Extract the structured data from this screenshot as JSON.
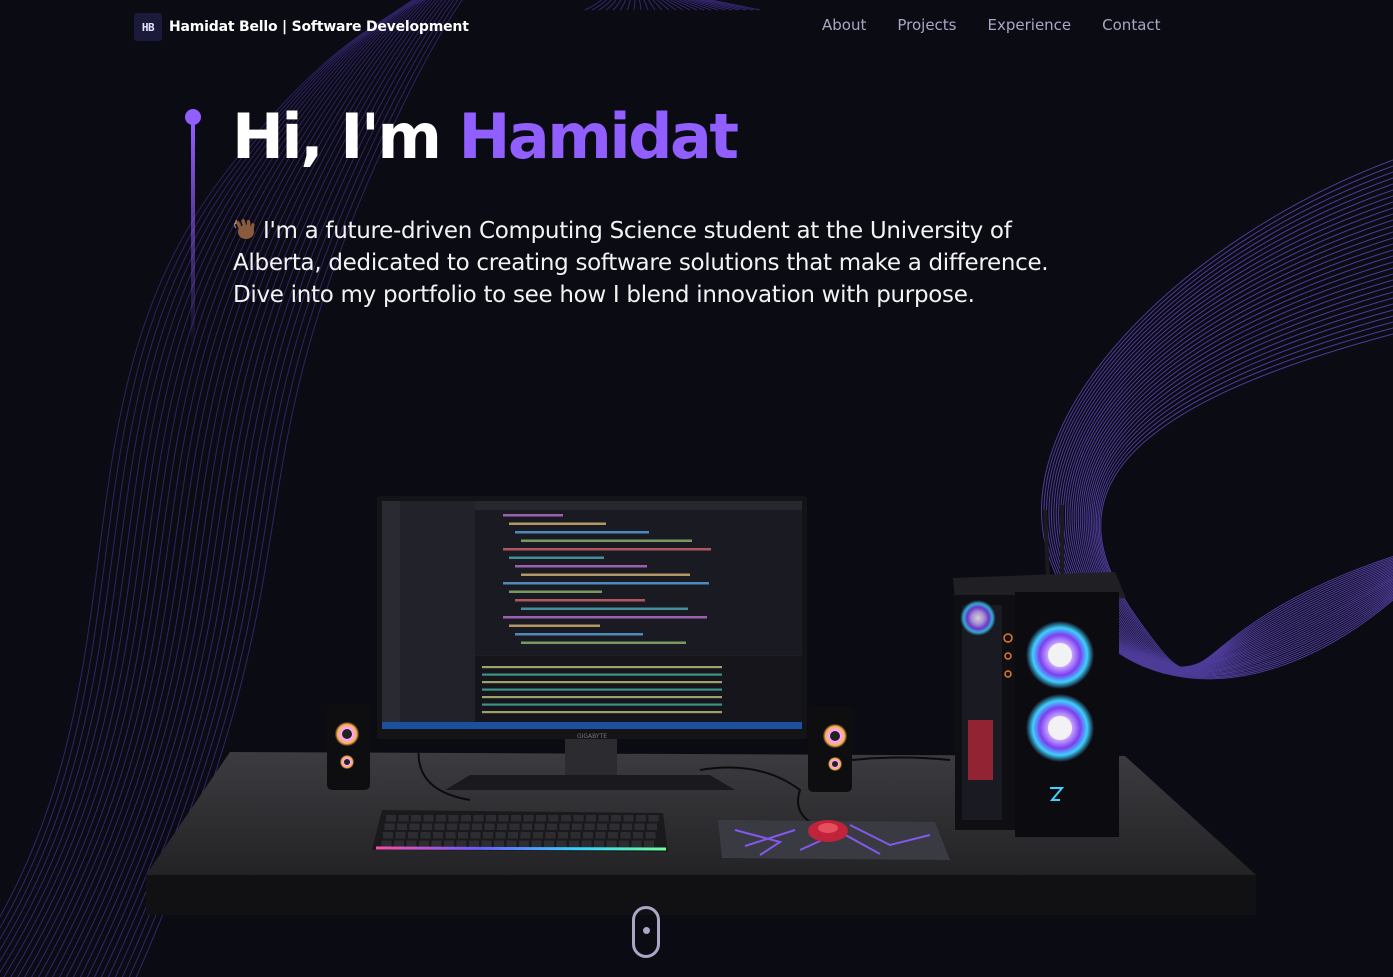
{
  "navbar": {
    "logo_text": "HB",
    "brand": "Hamidat Bello  | Software Development",
    "links": [
      {
        "label": "About"
      },
      {
        "label": "Projects"
      },
      {
        "label": "Experience"
      },
      {
        "label": "Contact"
      }
    ]
  },
  "hero": {
    "greeting": "Hi, I'm ",
    "name": "Hamidat",
    "intro": "I'm a future-driven Computing Science student at the University of Alberta, dedicated to creating software solutions that make a difference. Dive into my portfolio to see how I blend innovation with purpose."
  },
  "scene": {
    "monitor_brand": "GIGABYTE"
  },
  "colors": {
    "accent": "#915eff",
    "background": "#0b0b14",
    "nav_text": "#aaa6c3"
  },
  "icons": {
    "wave": "waving-hand-icon",
    "scroll": "scroll-down-icon"
  }
}
